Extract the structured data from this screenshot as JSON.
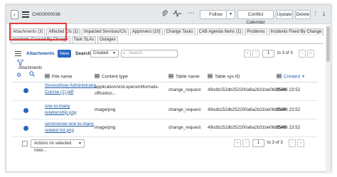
{
  "header": {
    "record_number": "CHG0000038",
    "follow_label": "Follow",
    "buttons": [
      "Conflict Calendar",
      "Update",
      "Delete"
    ]
  },
  "tabs": {
    "row1": [
      "Attachments (3)",
      "Affected CIs (1)",
      "Impacted Services/CIs",
      "Approvers (10)",
      "Change Tasks",
      "CAB Agenda Items (1)",
      "Problems",
      "Incidents Fixed By Change"
    ],
    "row2": [
      "Incidents Caused By Change",
      "Task SLAs",
      "Outages"
    ]
  },
  "list": {
    "title": "Attachments",
    "new_label": "New",
    "search_label": "Search",
    "search_field": "Created",
    "search_placeholder": "Search",
    "pager_top": {
      "page": "1",
      "text": "to 3 of 3"
    },
    "pager_bottom": {
      "page": "1",
      "text": "to 3 of 3"
    },
    "breadcrumb": "Attachments",
    "columns": [
      "File name",
      "Content type",
      "Table name",
      "Table sys ID",
      "Created"
    ],
    "sorted_column": "Created",
    "rows": [
      {
        "file_name": "ServiceNow Administrator Course (1).pdf",
        "content_type": "application/vnd.openxmlformats-officedoc...",
        "table_name": "change_request",
        "table_sys_id": "49cdb152db252200a6a2b31be0b8f548",
        "created": "25/06 23:52"
      },
      {
        "file_name": "one-to-many relationship.png",
        "content_type": "image/png",
        "table_name": "change_request",
        "table_sys_id": "49cdb152db252200a6a2b31be0b8f548",
        "created": "25/06 23:52"
      },
      {
        "file_name": "servicenow-one-to-many related list.png",
        "content_type": "image/png",
        "table_name": "change_request",
        "table_sys_id": "49cdb152db252200a6a2b31be0b8f548",
        "created": "25/06 23:52"
      }
    ],
    "actions_label": "Actions on selected rows..."
  },
  "icons": {
    "back": "chevron-left-icon",
    "attachment": "paperclip-icon",
    "activity": "activity-icon",
    "more": "more-icon",
    "up": "arrow-up-icon",
    "down": "arrow-down-icon"
  },
  "colors": {
    "accent": "#2766c1",
    "highlight": "#e33b3b",
    "header_bg": "#e6e9eb"
  }
}
